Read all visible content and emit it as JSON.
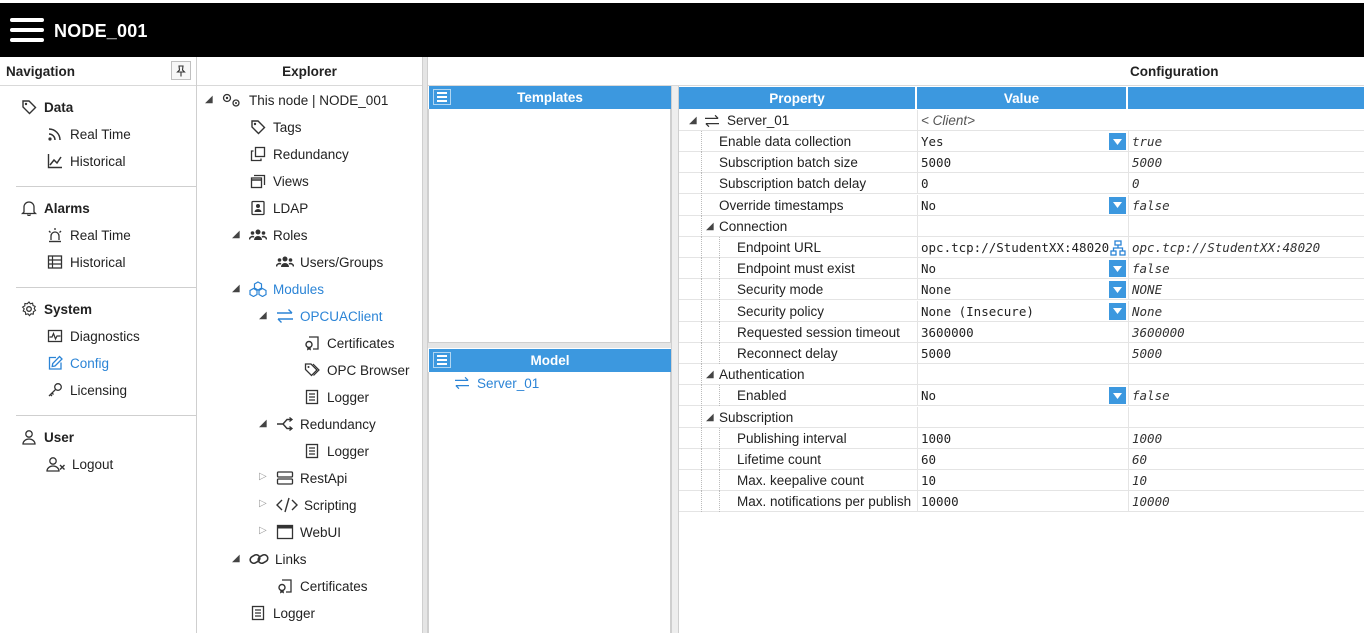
{
  "app": {
    "title": "NODE_001"
  },
  "navigation": {
    "header": "Navigation",
    "groups": [
      {
        "label": "Data",
        "icon": "tag-icon",
        "items": [
          {
            "label": "Real Time",
            "icon": "rss-icon"
          },
          {
            "label": "Historical",
            "icon": "line-chart-icon"
          }
        ]
      },
      {
        "label": "Alarms",
        "icon": "bell-icon",
        "items": [
          {
            "label": "Real Time",
            "icon": "alarm-light-icon"
          },
          {
            "label": "Historical",
            "icon": "table-icon"
          }
        ]
      },
      {
        "label": "System",
        "icon": "gear-icon",
        "items": [
          {
            "label": "Diagnostics",
            "icon": "pulse-icon"
          },
          {
            "label": "Config",
            "icon": "edit-icon",
            "active": true
          },
          {
            "label": "Licensing",
            "icon": "key-icon"
          }
        ]
      },
      {
        "label": "User",
        "icon": "user-icon",
        "items": [
          {
            "label": "Logout",
            "icon": "user-logout-icon"
          }
        ]
      }
    ]
  },
  "explorer": {
    "header": "Explorer",
    "tree": {
      "root": "This node | NODE_001",
      "tags": "Tags",
      "redundancy": "Redundancy",
      "views": "Views",
      "ldap": "LDAP",
      "roles": "Roles",
      "users_groups": "Users/Groups",
      "modules": "Modules",
      "opcuaclient": "OPCUAClient",
      "certificates": "Certificates",
      "opc_browser": "OPC Browser",
      "logger": "Logger",
      "mod_redundancy": "Redundancy",
      "mod_redundancy_logger": "Logger",
      "restapi": "RestApi",
      "scripting": "Scripting",
      "webui": "WebUI",
      "links": "Links",
      "links_certificates": "Certificates",
      "root_logger": "Logger"
    }
  },
  "configuration": {
    "header": "Configuration",
    "templates": {
      "header": "Templates"
    },
    "model": {
      "header": "Model",
      "items": [
        "Server_01"
      ]
    },
    "grid": {
      "headers": {
        "property": "Property",
        "value": "Value",
        "default": ""
      },
      "root": {
        "name": "Server_01",
        "value": "< Client>"
      },
      "rows": [
        {
          "property": "Enable data collection",
          "value": "Yes",
          "default": "true"
        },
        {
          "property": "Subscription batch size",
          "value": "5000",
          "default": "5000"
        },
        {
          "property": "Subscription batch delay",
          "value": "0",
          "default": "0"
        },
        {
          "property": "Override timestamps",
          "value": "No",
          "default": "false"
        },
        {
          "property": "Connection",
          "value": "",
          "default": ""
        },
        {
          "property": "Endpoint URL",
          "value": "opc.tcp://StudentXX:48020",
          "default": "opc.tcp://StudentXX:48020"
        },
        {
          "property": "Endpoint must exist",
          "value": "No",
          "default": "false"
        },
        {
          "property": "Security mode",
          "value": "None",
          "default": "NONE"
        },
        {
          "property": "Security policy",
          "value": "None (Insecure)",
          "default": "None"
        },
        {
          "property": "Requested session timeout",
          "value": "3600000",
          "default": "3600000"
        },
        {
          "property": "Reconnect delay",
          "value": "5000",
          "default": "5000"
        },
        {
          "property": "Authentication",
          "value": "",
          "default": ""
        },
        {
          "property": "Enabled",
          "value": "No",
          "default": "false"
        },
        {
          "property": "Subscription",
          "value": "",
          "default": ""
        },
        {
          "property": "Publishing interval",
          "value": "1000",
          "default": "1000"
        },
        {
          "property": "Lifetime count",
          "value": "60",
          "default": "60"
        },
        {
          "property": "Max. keepalive count",
          "value": "10",
          "default": "10"
        },
        {
          "property": "Max. notifications per publish",
          "value": "10000",
          "default": "10000"
        }
      ]
    }
  },
  "colors": {
    "accent": "#3c98df",
    "active_link": "#2b84d6",
    "topbar": "#000000"
  }
}
